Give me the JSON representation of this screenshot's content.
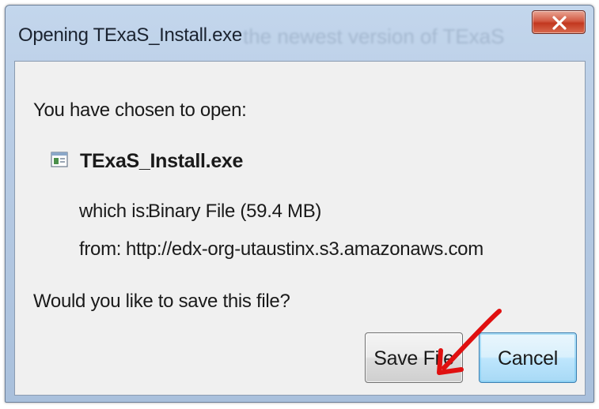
{
  "window": {
    "title": "Opening TExaS_Install.exe",
    "background_title": "the newest version of TExaS",
    "close_icon": "close-icon"
  },
  "dialog": {
    "prompt": "You have chosen to open:",
    "file_name": "TExaS_Install.exe",
    "file_icon": "file-icon",
    "which_is_label": "which is:",
    "which_is_value": "Binary File (59.4 MB)",
    "from_label": "from:",
    "from_value": "http://edx-org-utaustinx.s3.amazonaws.com",
    "question": "Would you like to save this file?"
  },
  "buttons": {
    "save_label": "Save File",
    "cancel_label": "Cancel"
  },
  "colors": {
    "annotation_arrow": "#e01010",
    "close_button": "#c7402a",
    "cancel_button_border": "#3c7fb1"
  }
}
